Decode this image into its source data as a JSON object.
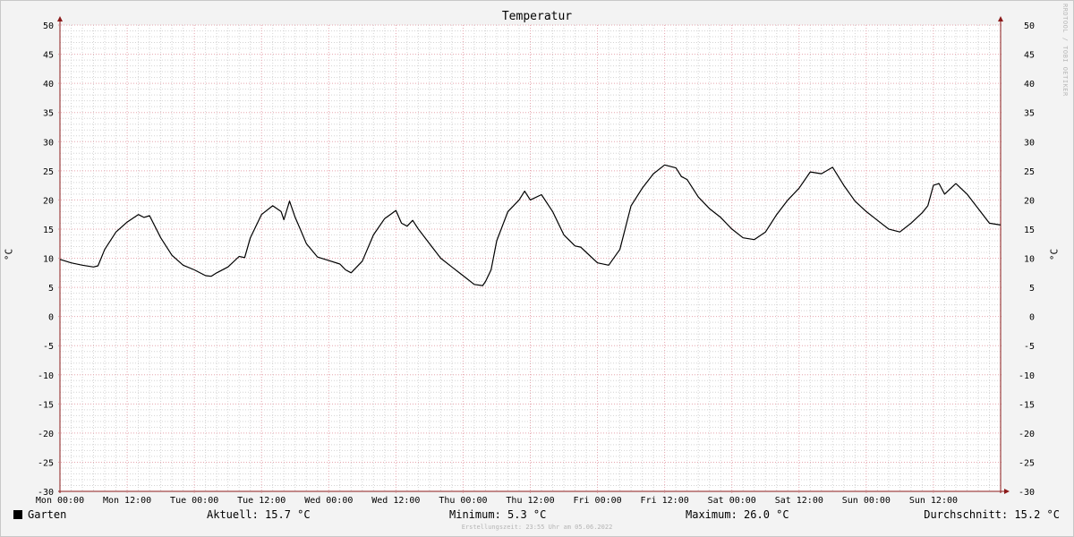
{
  "chart_data": {
    "type": "line",
    "title": "Temperatur",
    "ylabel": "°C",
    "ylabel_right": "°C",
    "ylim": [
      -30,
      50
    ],
    "yticks": [
      50,
      45,
      40,
      35,
      30,
      25,
      20,
      15,
      10,
      5,
      0,
      -5,
      -10,
      -15,
      -20,
      -25,
      -30
    ],
    "xlim_hours": [
      0,
      168
    ],
    "xtick_labels": [
      "Mon 00:00",
      "Mon 12:00",
      "Tue 00:00",
      "Tue 12:00",
      "Wed 00:00",
      "Wed 12:00",
      "Thu 00:00",
      "Thu 12:00",
      "Fri 00:00",
      "Fri 12:00",
      "Sat 00:00",
      "Sat 12:00",
      "Sun 00:00",
      "Sun 12:00"
    ],
    "grid": true,
    "legend_position": "bottom-left",
    "series": [
      {
        "name": "Garten",
        "color": "#000000",
        "x": [
          0,
          2,
          4,
          6,
          6.8,
          8,
          10,
          12,
          14,
          15,
          16,
          18,
          20,
          22,
          24,
          26,
          27,
          28,
          30,
          32,
          33,
          34,
          36,
          38,
          39.5,
          40,
          41,
          42,
          43,
          44,
          46,
          48,
          50,
          51,
          52,
          54,
          56,
          58,
          59,
          60,
          61,
          62,
          63,
          64,
          66,
          68,
          70,
          72,
          74,
          75.5,
          76,
          77,
          78,
          80,
          82,
          83,
          84,
          86,
          88,
          90,
          92,
          93,
          94,
          96,
          98,
          100,
          102,
          104,
          106,
          108,
          110,
          111,
          112,
          114,
          116,
          118,
          120,
          122,
          124,
          126,
          128,
          130,
          132,
          134,
          136,
          138,
          140,
          142,
          144,
          146,
          148,
          150,
          152,
          154,
          155,
          156,
          157,
          158,
          160,
          162,
          164,
          166,
          168
        ],
        "values": [
          9.8,
          9.2,
          8.8,
          8.5,
          8.7,
          11.5,
          14.5,
          16.2,
          17.5,
          17.0,
          17.3,
          13.5,
          10.5,
          8.8,
          8.0,
          7.0,
          6.9,
          7.5,
          8.5,
          10.3,
          10.1,
          13.5,
          17.5,
          19.0,
          18.0,
          16.6,
          19.8,
          17.0,
          14.8,
          12.5,
          10.2,
          9.6,
          9.0,
          8.0,
          7.5,
          9.5,
          14.0,
          16.8,
          17.5,
          18.2,
          16.0,
          15.5,
          16.5,
          15.0,
          12.5,
          10.0,
          8.5,
          7.0,
          5.5,
          5.3,
          6.0,
          8.0,
          13.0,
          18.0,
          20.0,
          21.5,
          20.0,
          20.9,
          18.0,
          14.0,
          12.1,
          11.9,
          11.0,
          9.2,
          8.8,
          11.5,
          19.0,
          22.0,
          24.5,
          26.0,
          25.5,
          24.0,
          23.5,
          20.5,
          18.5,
          17.0,
          15.0,
          13.5,
          13.2,
          14.5,
          17.5,
          20.0,
          22.0,
          24.8,
          24.5,
          25.6,
          22.5,
          19.8,
          18.0,
          16.5,
          15.0,
          14.5,
          16.0,
          17.8,
          19.0,
          22.5,
          22.8,
          21.0,
          22.8,
          21.0,
          18.5,
          16.0,
          15.7
        ]
      }
    ],
    "stats": {
      "current": "Aktuell: 15.7 °C",
      "minimum": "Minimum: 5.3 °C",
      "maximum": "Maximum: 26.0 °C",
      "average": "Durchschnitt: 15.2 °C"
    },
    "footer": "Erstellungszeit: 23:55 Uhr am 05.06.2022",
    "vendor": "RRDTOOL / TOBI OETIKER",
    "colors": {
      "grid_major": "#e6a5ae",
      "grid_minor": "#d4d4d4",
      "axis": "#8b1a1a",
      "background": "#ffffff",
      "line": "#000000"
    }
  }
}
